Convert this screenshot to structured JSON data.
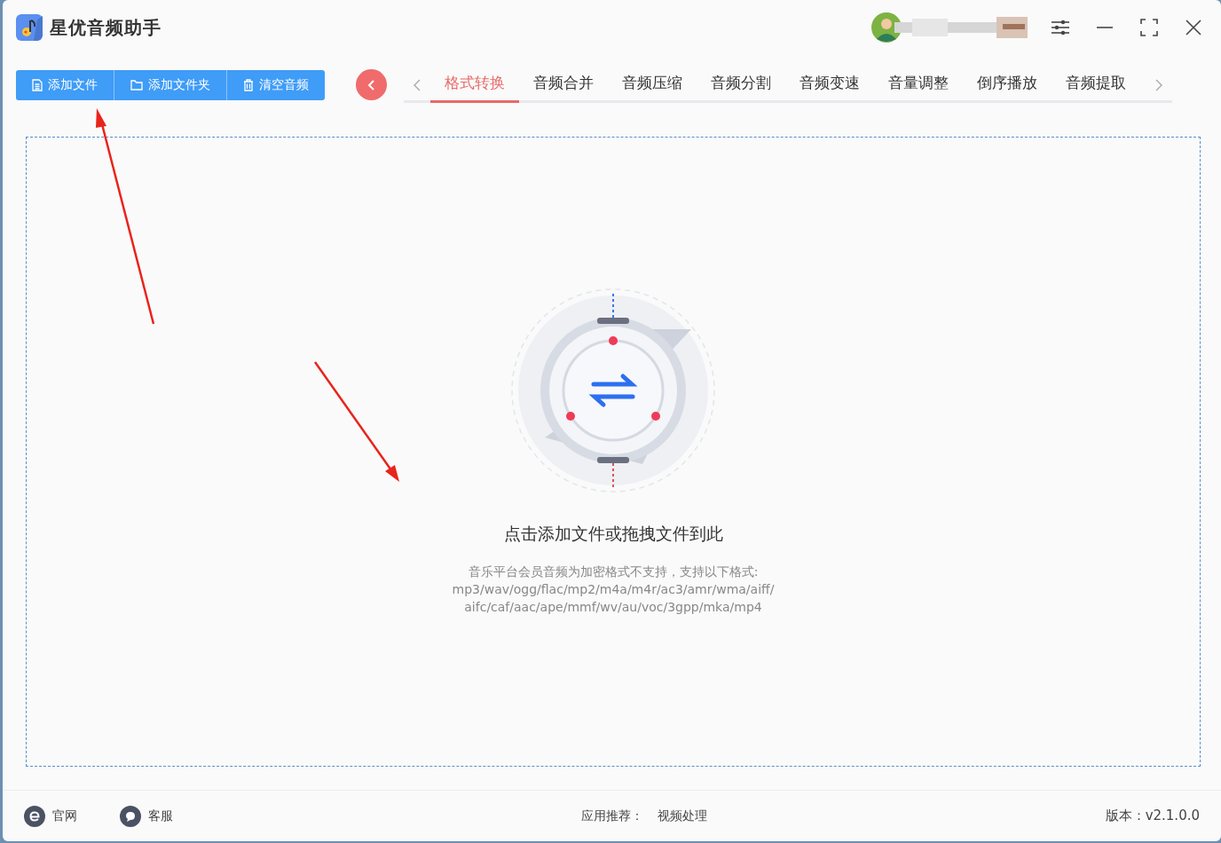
{
  "app": {
    "title": "星优音频助手"
  },
  "toolbar": {
    "buttons": [
      {
        "label": "添加文件",
        "kind": "file"
      },
      {
        "label": "添加文件夹",
        "kind": "folder"
      },
      {
        "label": "清空音频",
        "kind": "trash"
      }
    ]
  },
  "tabs": [
    {
      "label": "格式转换",
      "selected": true
    },
    {
      "label": "音频合并",
      "selected": false
    },
    {
      "label": "音频压缩",
      "selected": false
    },
    {
      "label": "音频分割",
      "selected": false
    },
    {
      "label": "音频变速",
      "selected": false
    },
    {
      "label": "音量调整",
      "selected": false
    },
    {
      "label": "倒序播放",
      "selected": false
    },
    {
      "label": "音频提取",
      "selected": false
    }
  ],
  "drop_zone": {
    "heading": "点击添加文件或拖拽文件到此",
    "note_lines": [
      "音乐平台会员音频为加密格式不支持，支持以下格式:",
      "mp3/wav/ogg/flac/mp2/m4a/m4r/ac3/amr/wma/aiff/",
      "aifc/caf/aac/ape/mmf/wv/au/voc/3gpp/mka/mp4"
    ]
  },
  "footer": {
    "links": [
      {
        "label": "官网",
        "kind": "web"
      },
      {
        "label": "客服",
        "kind": "chat"
      }
    ],
    "recommend_label": "应用推荐：",
    "recommend_link": "视频处理",
    "version": "版本：v2.1.0.0"
  }
}
